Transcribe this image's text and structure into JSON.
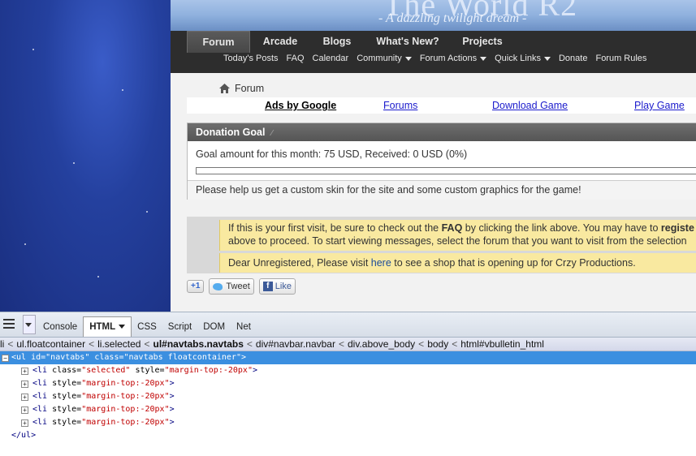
{
  "site": {
    "banner_title": "The World R2",
    "banner_subtitle": "- A dazzling twilight dream -",
    "navtabs": [
      "Forum",
      "Arcade",
      "Blogs",
      "What's New?",
      "Projects"
    ],
    "subnav": [
      {
        "label": "Today's Posts",
        "dropdown": false
      },
      {
        "label": "FAQ",
        "dropdown": false
      },
      {
        "label": "Calendar",
        "dropdown": false
      },
      {
        "label": "Community",
        "dropdown": true
      },
      {
        "label": "Forum Actions",
        "dropdown": true
      },
      {
        "label": "Quick Links",
        "dropdown": true
      },
      {
        "label": "Donate",
        "dropdown": false
      },
      {
        "label": "Forum Rules",
        "dropdown": false
      }
    ],
    "breadcrumb": "Forum",
    "ads": {
      "label": "Ads by Google",
      "links": [
        "Forums",
        "Download Game",
        "Play Game"
      ]
    },
    "donation": {
      "title": "Donation Goal",
      "goal_text": "Goal amount for this month: 75 USD, Received: 0 USD (0%)",
      "progress": 0,
      "footer": "Please help us get a custom skin for the site and some custom graphics for the game!"
    },
    "notices": {
      "n1_pre": "If this is your first visit, be sure to check out the ",
      "n1_faq": "FAQ",
      "n1_mid": " by clicking the link above. You may have to ",
      "n1_reg": "registe",
      "n1_line2": "above to proceed. To start viewing messages, select the forum that you want to visit from the selection",
      "n2_pre": "Dear Unregistered, Please visit ",
      "n2_link": "here",
      "n2_post": " to see a shop that is opening up for Crzy Productions."
    },
    "social": {
      "gplus": "+1",
      "tweet": "Tweet",
      "like": "Like"
    }
  },
  "firebug": {
    "tabs": [
      "Console",
      "HTML",
      "CSS",
      "Script",
      "DOM",
      "Net"
    ],
    "active_tab": "HTML",
    "breadcrumbs": [
      "li",
      "ul.floatcontainer",
      "li.selected",
      "ul#navtabs.navtabs",
      "div#navbar.navbar",
      "div.above_body",
      "body",
      "html#vbulletin_html"
    ],
    "bold_crumb": "ul#navtabs.navtabs",
    "tree": {
      "selected_open": "<ul",
      "selected_attr1": " id=",
      "selected_val1": "\"navtabs\"",
      "selected_attr2": " class=",
      "selected_val2": "\"navtabs floatcontainer\"",
      "selected_end": ">",
      "children": [
        {
          "class_attr": " class=",
          "class_val": "\"selected\"",
          "style_val": "\"margin-top:-20px\""
        },
        {
          "class_attr": "",
          "class_val": "",
          "style_val": "\"margin-top:-20px\""
        },
        {
          "class_attr": "",
          "class_val": "",
          "style_val": "\"margin-top:-20px\""
        },
        {
          "class_attr": "",
          "class_val": "",
          "style_val": "\"margin-top:-20px\""
        },
        {
          "class_attr": "",
          "class_val": "",
          "style_val": "\"margin-top:-20px\""
        }
      ],
      "li_open": "<li",
      "style_attr": " style=",
      "tag_end": ">",
      "closing": "</ul>"
    }
  }
}
